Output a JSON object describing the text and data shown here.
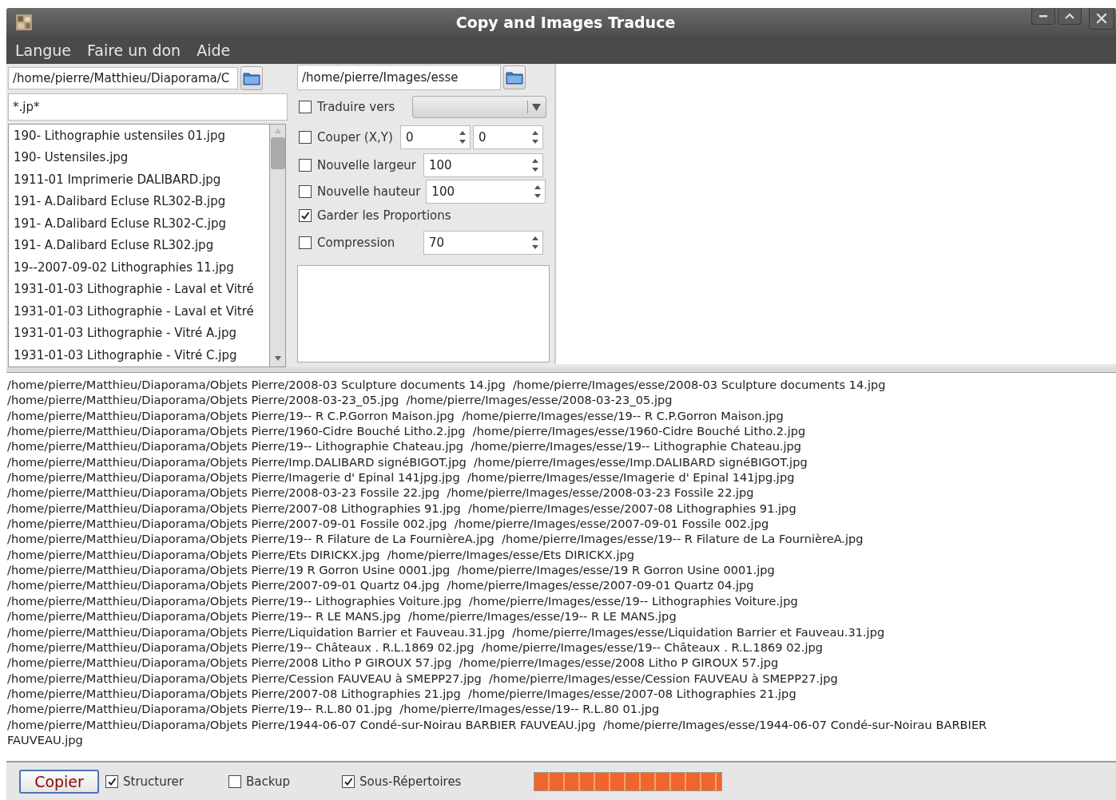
{
  "window": {
    "title": "Copy and Images Traduce"
  },
  "menu": [
    "Langue",
    "Faire un don",
    "Aide"
  ],
  "source": {
    "path": "/home/pierre/Matthieu/Diaporama/C",
    "filter": "*.jp*",
    "files": [
      "190- Lithographie ustensiles 01.jpg",
      "190- Ustensiles.jpg",
      "1911-01 Imprimerie DALIBARD.jpg",
      "191- A.Dalibard Ecluse RL302-B.jpg",
      "191- A.Dalibard Ecluse RL302-C.jpg",
      "191- A.Dalibard Ecluse RL302.jpg",
      "19--2007-09-02 Lithographies 11.jpg",
      "1931-01-03 Lithographie - Laval et Vitré",
      "1931-01-03 Lithographie - Laval et Vitré",
      "1931-01-03 Lithographie - Vitré A.jpg",
      "1931-01-03 Lithographie - Vitré C.jpg"
    ]
  },
  "destination": {
    "path": "/home/pierre/Images/esse"
  },
  "options": [
    {
      "kind": "combo",
      "label": "Traduire vers",
      "checked": false
    },
    {
      "kind": "spin2",
      "label": "Couper (X,Y)",
      "checked": false,
      "values": [
        "0",
        "0"
      ]
    },
    {
      "kind": "spin",
      "label": "Nouvelle largeur",
      "checked": false,
      "value": "100"
    },
    {
      "kind": "spin",
      "label": "Nouvelle hauteur",
      "checked": false,
      "value": "100"
    },
    {
      "kind": "check",
      "label": "Garder les Proportions",
      "checked": true
    },
    {
      "kind": "spin",
      "label": "Compression",
      "checked": false,
      "value": "70"
    }
  ],
  "log": [
    "/home/pierre/Matthieu/Diaporama/Objets Pierre/2008-03 Sculpture documents 14.jpg  /home/pierre/Images/esse/2008-03 Sculpture documents 14.jpg",
    "/home/pierre/Matthieu/Diaporama/Objets Pierre/2008-03-23_05.jpg  /home/pierre/Images/esse/2008-03-23_05.jpg",
    "/home/pierre/Matthieu/Diaporama/Objets Pierre/19-- R C.P.Gorron Maison.jpg  /home/pierre/Images/esse/19-- R C.P.Gorron Maison.jpg",
    "/home/pierre/Matthieu/Diaporama/Objets Pierre/1960-Cidre Bouché Litho.2.jpg  /home/pierre/Images/esse/1960-Cidre Bouché Litho.2.jpg",
    "/home/pierre/Matthieu/Diaporama/Objets Pierre/19-- Lithographie Chateau.jpg  /home/pierre/Images/esse/19-- Lithographie Chateau.jpg",
    "/home/pierre/Matthieu/Diaporama/Objets Pierre/Imp.DALIBARD signéBIGOT.jpg  /home/pierre/Images/esse/Imp.DALIBARD signéBIGOT.jpg",
    "/home/pierre/Matthieu/Diaporama/Objets Pierre/Imagerie d' Epinal 141jpg.jpg  /home/pierre/Images/esse/Imagerie d' Epinal 141jpg.jpg",
    "/home/pierre/Matthieu/Diaporama/Objets Pierre/2008-03-23 Fossile 22.jpg  /home/pierre/Images/esse/2008-03-23 Fossile 22.jpg",
    "/home/pierre/Matthieu/Diaporama/Objets Pierre/2007-08 Lithographies 91.jpg  /home/pierre/Images/esse/2007-08 Lithographies 91.jpg",
    "/home/pierre/Matthieu/Diaporama/Objets Pierre/2007-09-01 Fossile 002.jpg  /home/pierre/Images/esse/2007-09-01 Fossile 002.jpg",
    "/home/pierre/Matthieu/Diaporama/Objets Pierre/19-- R Filature de La FournièreA.jpg  /home/pierre/Images/esse/19-- R Filature de La FournièreA.jpg",
    "/home/pierre/Matthieu/Diaporama/Objets Pierre/Ets DIRICKX.jpg  /home/pierre/Images/esse/Ets DIRICKX.jpg",
    "/home/pierre/Matthieu/Diaporama/Objets Pierre/19 R Gorron Usine 0001.jpg  /home/pierre/Images/esse/19 R Gorron Usine 0001.jpg",
    "/home/pierre/Matthieu/Diaporama/Objets Pierre/2007-09-01 Quartz 04.jpg  /home/pierre/Images/esse/2007-09-01 Quartz 04.jpg",
    "/home/pierre/Matthieu/Diaporama/Objets Pierre/19-- Lithographies Voiture.jpg  /home/pierre/Images/esse/19-- Lithographies Voiture.jpg",
    "/home/pierre/Matthieu/Diaporama/Objets Pierre/19-- R LE MANS.jpg  /home/pierre/Images/esse/19-- R LE MANS.jpg",
    "/home/pierre/Matthieu/Diaporama/Objets Pierre/Liquidation Barrier et Fauveau.31.jpg  /home/pierre/Images/esse/Liquidation Barrier et Fauveau.31.jpg",
    "/home/pierre/Matthieu/Diaporama/Objets Pierre/19-- Châteaux . R.L.1869 02.jpg  /home/pierre/Images/esse/19-- Châteaux . R.L.1869 02.jpg",
    "/home/pierre/Matthieu/Diaporama/Objets Pierre/2008 Litho P GIROUX 57.jpg  /home/pierre/Images/esse/2008 Litho P GIROUX 57.jpg",
    "/home/pierre/Matthieu/Diaporama/Objets Pierre/Cession FAUVEAU à SMEPP27.jpg  /home/pierre/Images/esse/Cession FAUVEAU à SMEPP27.jpg",
    "/home/pierre/Matthieu/Diaporama/Objets Pierre/2007-08 Lithographies 21.jpg  /home/pierre/Images/esse/2007-08 Lithographies 21.jpg",
    "/home/pierre/Matthieu/Diaporama/Objets Pierre/19-- R.L.80 01.jpg  /home/pierre/Images/esse/19-- R.L.80 01.jpg",
    "/home/pierre/Matthieu/Diaporama/Objets Pierre/1944-06-07 Condé-sur-Noirau BARBIER FAUVEAU.jpg  /home/pierre/Images/esse/1944-06-07 Condé-sur-Noirau BARBIER FAUVEAU.jpg"
  ],
  "bottom": {
    "button": "Copier",
    "checks": [
      {
        "label": "Structurer",
        "checked": true
      },
      {
        "label": "Backup",
        "checked": false
      },
      {
        "label": "Sous-Répertoires",
        "checked": true
      }
    ],
    "progress": {
      "level": 1
    }
  }
}
